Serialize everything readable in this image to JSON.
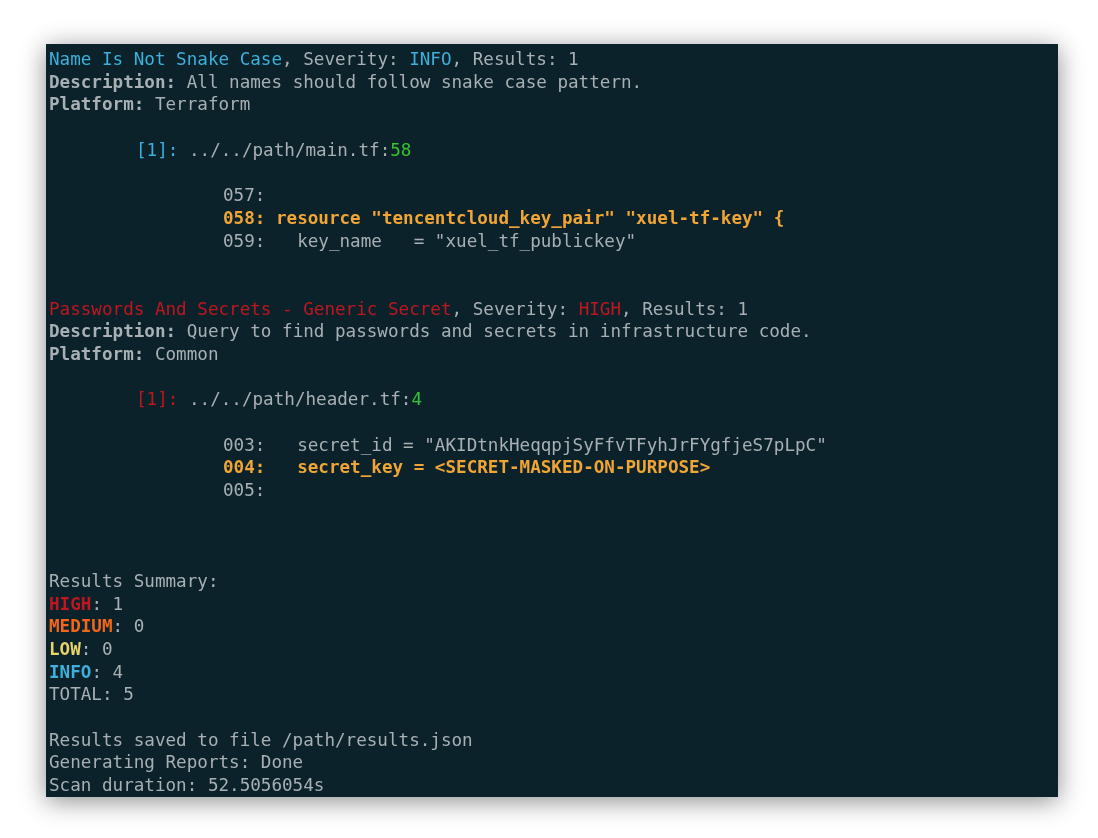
{
  "findings": [
    {
      "title": "Name Is Not Snake Case",
      "severity_label": ", Severity:",
      "severity": "INFO",
      "results_label": ", Results:",
      "results": "1",
      "description_label": "Description:",
      "description": "All names should follow snake case pattern.",
      "platform_label": "Platform:",
      "platform": "Terraform",
      "index": "[1]:",
      "file": "../../path/main.tf:",
      "line": "58",
      "code": [
        {
          "number": "057:",
          "highlighted": false
        },
        {
          "number": "058:",
          "text": "resource \"tencentcloud_key_pair\" \"xuel-tf-key\" {",
          "highlighted": true
        },
        {
          "number": "059:",
          "text": "  key_name   = \"xuel_tf_publickey\"",
          "highlighted": false
        }
      ]
    },
    {
      "title": "Passwords And Secrets - Generic Secret",
      "severity_label": ", Severity:",
      "severity": "HIGH",
      "results_label": ", Results:",
      "results": "1",
      "description_label": "Description:",
      "description": "Query to find passwords and secrets in infrastructure code.",
      "platform_label": "Platform:",
      "platform": "Common",
      "index": "[1]:",
      "file": "../../path/header.tf:",
      "line": "4",
      "code": [
        {
          "number": "003:",
          "text": "  secret_id = \"AKIDtnkHeqqpjSyFfvTFyhJrFYgfjeS7pLpC\"",
          "highlighted": false
        },
        {
          "number": "004:",
          "text": "  secret_key = <SECRET-MASKED-ON-PURPOSE>",
          "highlighted": true
        },
        {
          "number": "005:",
          "highlighted": false
        }
      ]
    }
  ],
  "summary": {
    "title": "Results Summary:",
    "items": [
      {
        "severity": "HIGH",
        "separator": ":",
        "count": "1"
      },
      {
        "severity": "MEDIUM",
        "separator": ":",
        "count": "0"
      },
      {
        "severity": "LOW",
        "separator": ":",
        "count": "0"
      },
      {
        "severity": "INFO",
        "separator": ":",
        "count": "4"
      }
    ],
    "total": "TOTAL: 5"
  },
  "footer": [
    "Results saved to file /path/results.json",
    "Generating Reports: Done",
    "Scan duration: 52.5056054s"
  ]
}
